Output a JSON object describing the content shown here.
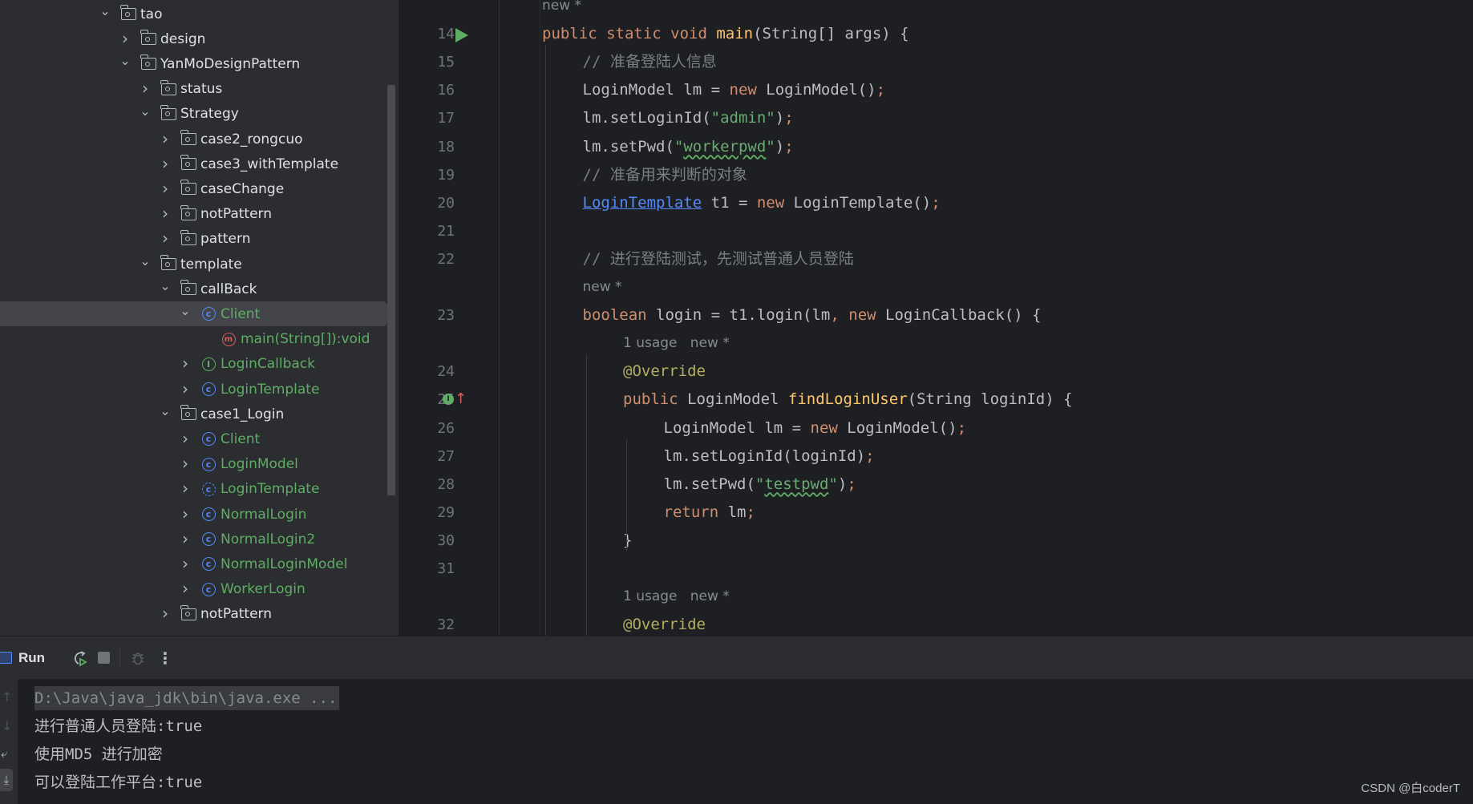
{
  "project_tree": {
    "items": [
      {
        "label": "tao",
        "type": "package",
        "depth": 0,
        "expanded": true
      },
      {
        "label": "design",
        "type": "package",
        "depth": 1,
        "expanded": false
      },
      {
        "label": "YanMoDesignPattern",
        "type": "package",
        "depth": 1,
        "expanded": true
      },
      {
        "label": "status",
        "type": "package",
        "depth": 2,
        "expanded": false
      },
      {
        "label": "Strategy",
        "type": "package",
        "depth": 2,
        "expanded": true
      },
      {
        "label": "case2_rongcuo",
        "type": "package",
        "depth": 3,
        "expanded": false
      },
      {
        "label": "case3_withTemplate",
        "type": "package",
        "depth": 3,
        "expanded": false
      },
      {
        "label": "caseChange",
        "type": "package",
        "depth": 3,
        "expanded": false
      },
      {
        "label": "notPattern",
        "type": "package",
        "depth": 3,
        "expanded": false
      },
      {
        "label": "pattern",
        "type": "package",
        "depth": 3,
        "expanded": false
      },
      {
        "label": "template",
        "type": "package",
        "depth": 2,
        "expanded": true
      },
      {
        "label": "callBack",
        "type": "package",
        "depth": 3,
        "expanded": true
      },
      {
        "label": "Client",
        "type": "class",
        "depth": 4,
        "expanded": true,
        "selected": true
      },
      {
        "label": "main(String[]):void",
        "type": "method",
        "depth": 5,
        "leaf": true
      },
      {
        "label": "LoginCallback",
        "type": "interface",
        "depth": 4,
        "expanded": false
      },
      {
        "label": "LoginTemplate",
        "type": "class",
        "depth": 4,
        "expanded": false
      },
      {
        "label": "case1_Login",
        "type": "package",
        "depth": 3,
        "expanded": true
      },
      {
        "label": "Client",
        "type": "class",
        "depth": 4,
        "expanded": false
      },
      {
        "label": "LoginModel",
        "type": "class",
        "depth": 4,
        "expanded": false
      },
      {
        "label": "LoginTemplate",
        "type": "abstract-class",
        "depth": 4,
        "expanded": false
      },
      {
        "label": "NormalLogin",
        "type": "class",
        "depth": 4,
        "expanded": false
      },
      {
        "label": "NormalLogin2",
        "type": "class",
        "depth": 4,
        "expanded": false
      },
      {
        "label": "NormalLoginModel",
        "type": "class",
        "depth": 4,
        "expanded": false
      },
      {
        "label": "WorkerLogin",
        "type": "class",
        "depth": 4,
        "expanded": false
      },
      {
        "label": "notPattern",
        "type": "package",
        "depth": 3,
        "expanded": false
      }
    ]
  },
  "editor": {
    "lines": [
      {
        "num": "",
        "hint": "new *",
        "indent": 0
      },
      {
        "num": "14",
        "gutter": "run-icon",
        "indent": 0,
        "tokens": [
          [
            "kw",
            "public static void "
          ],
          [
            "mn",
            "main"
          ],
          [
            "",
            "(String[] args) {"
          ]
        ]
      },
      {
        "num": "15",
        "indent": 1,
        "tokens": [
          [
            "cm",
            "// 准备登陆人信息"
          ]
        ]
      },
      {
        "num": "16",
        "indent": 1,
        "tokens": [
          [
            "",
            "LoginModel lm = "
          ],
          [
            "kw",
            "new "
          ],
          [
            "",
            "LoginModel()"
          ],
          [
            "semi",
            ";"
          ]
        ]
      },
      {
        "num": "17",
        "indent": 1,
        "tokens": [
          [
            "",
            "lm.setLoginId("
          ],
          [
            "str",
            "\"admin\""
          ],
          [
            "",
            ")"
          ],
          [
            "semi",
            ";"
          ]
        ]
      },
      {
        "num": "18",
        "indent": 1,
        "tokens": [
          [
            "",
            "lm.setPwd("
          ],
          [
            "str",
            "\""
          ],
          [
            "str squig",
            "workerpwd"
          ],
          [
            "str",
            "\""
          ],
          [
            "",
            ")"
          ],
          [
            "semi",
            ";"
          ]
        ]
      },
      {
        "num": "19",
        "indent": 1,
        "tokens": [
          [
            "cm",
            "// 准备用来判断的对象"
          ]
        ]
      },
      {
        "num": "20",
        "indent": 1,
        "tokens": [
          [
            "link",
            "LoginTemplate"
          ],
          [
            "",
            " t1 = "
          ],
          [
            "kw",
            "new "
          ],
          [
            "",
            "LoginTemplate()"
          ],
          [
            "semi",
            ";"
          ]
        ]
      },
      {
        "num": "21",
        "indent": 1,
        "tokens": []
      },
      {
        "num": "22",
        "indent": 1,
        "tokens": [
          [
            "cm",
            "// 进行登陆测试，先测试普通人员登陆"
          ]
        ]
      },
      {
        "num": "",
        "hint": "new *",
        "indent": 1
      },
      {
        "num": "23",
        "indent": 1,
        "tokens": [
          [
            "kw",
            "boolean "
          ],
          [
            "",
            "login = t1.login(lm"
          ],
          [
            "semi",
            ", "
          ],
          [
            "kw",
            "new "
          ],
          [
            "",
            "LoginCallback() {"
          ]
        ]
      },
      {
        "num": "",
        "hint": "1 usage   new *",
        "indent": 2
      },
      {
        "num": "24",
        "indent": 2,
        "tokens": [
          [
            "ann",
            "@Override"
          ]
        ]
      },
      {
        "num": "25",
        "gutter": "implements-icon",
        "indent": 2,
        "tokens": [
          [
            "kw",
            "public "
          ],
          [
            "",
            "LoginModel "
          ],
          [
            "mn",
            "findLoginUser"
          ],
          [
            "",
            "(String loginId) {"
          ]
        ]
      },
      {
        "num": "26",
        "indent": 3,
        "tokens": [
          [
            "",
            "LoginModel lm = "
          ],
          [
            "kw",
            "new "
          ],
          [
            "",
            "LoginModel()"
          ],
          [
            "semi",
            ";"
          ]
        ]
      },
      {
        "num": "27",
        "indent": 3,
        "tokens": [
          [
            "",
            "lm.setLoginId(loginId)"
          ],
          [
            "semi",
            ";"
          ]
        ]
      },
      {
        "num": "28",
        "indent": 3,
        "tokens": [
          [
            "",
            "lm.setPwd("
          ],
          [
            "str",
            "\""
          ],
          [
            "str squig",
            "testpwd"
          ],
          [
            "str",
            "\""
          ],
          [
            "",
            ")"
          ],
          [
            "semi",
            ";"
          ]
        ]
      },
      {
        "num": "29",
        "indent": 3,
        "tokens": [
          [
            "kw",
            "return "
          ],
          [
            "",
            "lm"
          ],
          [
            "semi",
            ";"
          ]
        ]
      },
      {
        "num": "30",
        "indent": 2,
        "tokens": [
          [
            "",
            "}"
          ]
        ]
      },
      {
        "num": "31",
        "indent": 2,
        "tokens": []
      },
      {
        "num": "",
        "hint": "1 usage   new *",
        "indent": 2
      },
      {
        "num": "32",
        "indent": 2,
        "tokens": [
          [
            "ann",
            "@Override"
          ]
        ]
      }
    ]
  },
  "run_panel": {
    "title": "Run",
    "toolbar": {
      "rerun": "rerun-icon",
      "stop": "stop-icon",
      "debug": "debug-icon",
      "more": "more-vertical-icon"
    },
    "console": [
      {
        "text": "D:\\Java\\java_jdk\\bin\\java.exe ...",
        "type": "command"
      },
      {
        "text": "进行普通人员登陆:true",
        "type": "output"
      },
      {
        "text": "使用MD5 进行加密",
        "type": "output"
      },
      {
        "text": "可以登陆工作平台:true",
        "type": "output"
      }
    ]
  },
  "watermark": "CSDN @白coderT",
  "colors": {
    "keyword": "#cf8e6d",
    "string": "#6aab73",
    "comment": "#7a7e85",
    "annotation": "#b3ae60",
    "method_decl": "#ffc66d",
    "class_icon": "#548af7",
    "tree_class_label": "#5fad65",
    "editor_bg": "#1e1f22",
    "panel_bg": "#2b2d30"
  }
}
